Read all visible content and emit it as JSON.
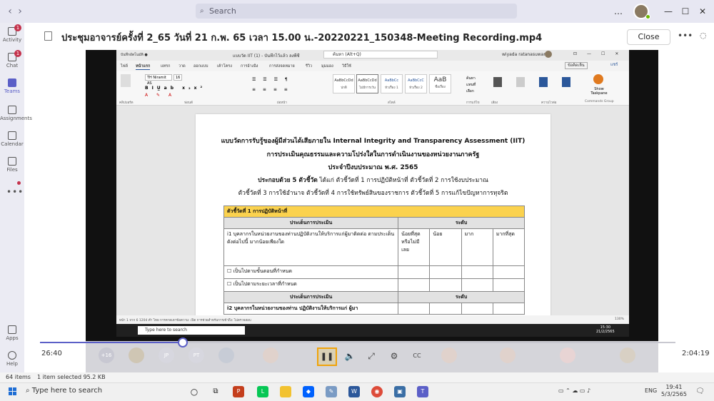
{
  "teams": {
    "search_placeholder": "Search",
    "window_controls": [
      "…",
      "—",
      "☐",
      "✕"
    ]
  },
  "rail": {
    "items": [
      {
        "label": "Activity",
        "badge": "1"
      },
      {
        "label": "Chat",
        "badge": "1"
      },
      {
        "label": "Teams",
        "badge": ""
      },
      {
        "label": "Assignments",
        "badge": ""
      },
      {
        "label": "Calendar",
        "badge": ""
      },
      {
        "label": "Files",
        "badge": ""
      }
    ],
    "bottom": [
      {
        "label": "Apps"
      },
      {
        "label": "Help"
      }
    ],
    "more": "•••"
  },
  "viewer": {
    "file_title": "ประชุมอาจารย์ครั้งที่ 2_65 วันที่ 21 ก.พ. 65 เวลา 15.00 น.-20220221_150348-Meeting Recording.mp4",
    "close_label": "Close",
    "more_label": "•••"
  },
  "word": {
    "title": "แบบวัด IIT (1) - บันทึกไว้แล้ว ลงพีซี",
    "search": "ค้นหา (Alt+Q)",
    "user": "wiyada ratanasuwan",
    "menu": [
      "ไฟล์",
      "หน้าแรก",
      "แทรก",
      "วาด",
      "ออกแบบ",
      "เค้าโครง",
      "การอ้างอิง",
      "การส่งจดหมาย",
      "รีวิว",
      "มุมมอง",
      "วิธีใช้"
    ],
    "share": "แชร์",
    "comment": "ข้อคิดเห็น",
    "font": "TH Niramit AS",
    "size": "16",
    "styles": [
      {
        "sample": "AaBbCcDd",
        "name": "ปกติ"
      },
      {
        "sample": "AaBbCcDd",
        "name": "ไม่มีการเว้น"
      },
      {
        "sample": "AaBbCc",
        "name": "หัวเรื่อง 1"
      },
      {
        "sample": "AaBbCcC",
        "name": "หัวเรื่อง 2"
      },
      {
        "sample": "AaB",
        "name": "ชื่อเรื่อง"
      }
    ],
    "group_labels": [
      "คลิปบอร์ด",
      "ฟอนต์",
      "ย่อหน้า",
      "สไตล์",
      "การแก้ไข",
      "เสียง",
      "ความไวต่อ",
      "Commands Group"
    ],
    "right_buttons": [
      "ค้นหา",
      "แทนที่",
      "เลือก",
      "บอก",
      "นำไปใช้",
      "Show Taskpane"
    ],
    "doc": {
      "h1": "แบบวัดการรับรู้ของผู้มีส่วนได้เสียภายใน Internal Integrity and Transparency Assessment (IIT)",
      "h2": "การประเมินคุณธรรมและความโปร่งใสในการดำเนินงานของหน่วยงานภาครัฐ",
      "h3": "ประจำปีงบประมาณ พ.ศ. 2565",
      "h4_bold": "ประกอบด้วย 5 ตัวชี้วัด",
      "h4_rest": " ได้แก่  ตัวชี้วัดที่ 1 การปฏิบัติหน้าที่    ตัวชี้วัดที่ 2 การใช้งบประมาณ",
      "h5": "ตัวชี้วัดที่ 3 การใช้อำนาจ   ตัวชี้วัดที่ 4 การใช้ทรัพย์สินของราชการ  ตัวชี้วัดที่ 5 การแก้ไขปัญหาการทุจริต",
      "table": {
        "section": "ตัวชี้วัดที่ 1 การปฏิบัติหน้าที่",
        "col_issue": "ประเด็นการประเมิน",
        "col_level": "ระดับ",
        "q1": "i1 บุคลากรในหน่วยงานของท่านปฏิบัติงานให้บริการแก่ผู้มาติดต่อ ตามประเด็นดังต่อไปนี้ มากน้อยเพียงใด",
        "levels": [
          "น้อยที่สุด หรือไม่มีเลย",
          "น้อย",
          "มาก",
          "มากที่สุด"
        ],
        "opt1": "☐ เป็นไปตามขั้นตอนที่กำหนด",
        "opt2": "☐ เป็นไปตามระยะเวลาที่กำหนด",
        "q2": "i2 บุคลากรในหน่วยงานของท่าน ปฏิบัติงานให้บริการแก่ ผู้มา"
      }
    },
    "status": "หน้า 1 จาก 6    1204 คำ    ไทย    การคาดเดาข้อความ: เปิด    การช่วยสำหรับการเข้าถึง: ไปตรวจสอบ",
    "zoom": "130%",
    "taskbar_search": "Type here to search",
    "taskbar_time": "15:30",
    "taskbar_date": "21/2/2565"
  },
  "playback": {
    "current": "26:40",
    "total": "2:04:19",
    "progress_pct": 22.5,
    "extra_participants": "+16",
    "initials": [
      "JP",
      "PT"
    ]
  },
  "explorer": {
    "items": "64 items",
    "selected": "1 item selected  95.2 KB"
  },
  "taskbar": {
    "search": "Type here to search",
    "lang": "ENG",
    "time": "19:41",
    "date": "5/3/2565"
  },
  "colors": {
    "accent": "#5b5fc7",
    "badge": "#c4314b",
    "highlight": "#fbd24e"
  }
}
